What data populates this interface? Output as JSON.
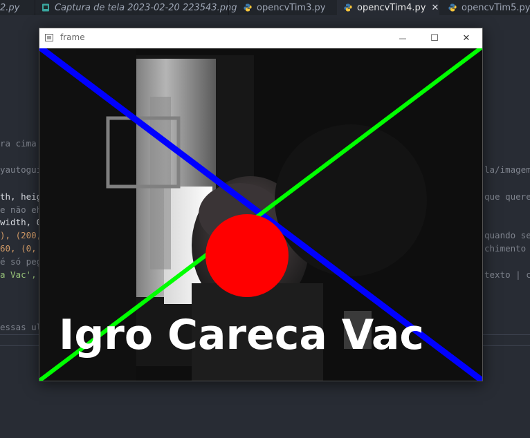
{
  "tabs": [
    {
      "label": "2.py",
      "icon": "python-icon",
      "italic": true
    },
    {
      "label": "Captura de tela 2023-02-20 223543.png",
      "icon": "image-file-icon",
      "italic": true
    },
    {
      "label": "opencvTim3.py",
      "icon": "python-icon",
      "italic": false
    },
    {
      "label": "opencvTim4.py",
      "icon": "python-icon",
      "italic": false,
      "active": true
    },
    {
      "label": "opencvTim5.py",
      "icon": "python-icon",
      "italic": false
    }
  ],
  "tab_close": "✕",
  "code_left": [
    {
      "text": "ra cima ",
      "cls": "c-comment"
    },
    {
      "text": "yautogui",
      "cls": "c-comment"
    },
    {
      "text": "th, heig",
      "cls": "c-white"
    },
    {
      "text": "e não eh",
      "cls": "c-comment"
    },
    {
      "text": "width, 0",
      "cls": "c-white"
    },
    {
      "text": "), (200,",
      "cls": "c-num"
    },
    {
      "text": "60, (0, ",
      "cls": "c-num"
    },
    {
      "text": "é só peg",
      "cls": "c-comment"
    },
    {
      "text": "a Vac',",
      "cls": "c-str"
    },
    {
      "text": "essas ul",
      "cls": "c-comment"
    }
  ],
  "code_right": [
    {
      "text": "la/imagem"
    },
    {
      "text": "que queremo"
    },
    {
      "text": "quando se"
    },
    {
      "text": "chimento"
    },
    {
      "text": "texto | co"
    }
  ],
  "window": {
    "title": "frame",
    "min": "—",
    "max": "☐",
    "close": "✕"
  },
  "frame": {
    "overlay_text": "Igro Careca Vac",
    "shapes": {
      "line_blue": "#0000ff",
      "line_green": "#00ff00",
      "circle": "#ff0000",
      "rectangle": "#808080",
      "text": "#ffffff"
    }
  }
}
